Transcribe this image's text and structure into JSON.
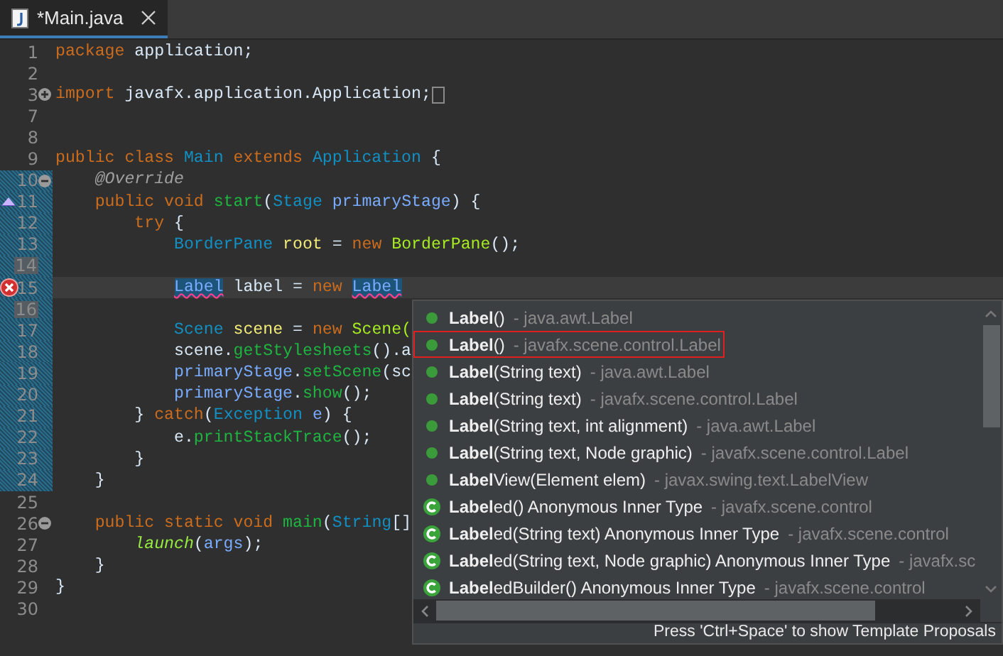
{
  "tab": {
    "title": "*Main.java",
    "dirty": true
  },
  "lines": [
    {
      "number": "1",
      "tokens": [
        {
          "kind": "keyword",
          "text": "package"
        },
        {
          "kind": "plain",
          "text": " application;"
        }
      ]
    },
    {
      "number": "2"
    },
    {
      "number": "3",
      "gutter_icon": {
        "kind": "expand"
      },
      "tokens": [
        {
          "kind": "keyword",
          "text": "import"
        },
        {
          "kind": "plain",
          "text": " javafx.application.Application;"
        }
      ],
      "folded": true
    },
    {
      "number": "7"
    },
    {
      "number": "8"
    },
    {
      "number": "9",
      "tokens": [
        {
          "kind": "keyword",
          "text": "public class "
        },
        {
          "kind": "type",
          "text": "Main"
        },
        {
          "kind": "keyword",
          "text": " extends "
        },
        {
          "kind": "type",
          "text": "Application"
        },
        {
          "kind": "plain",
          "text": " {"
        }
      ]
    },
    {
      "number": "10",
      "gutter_icon": {
        "kind": "collapse"
      },
      "changed": true,
      "tokens": [
        {
          "kind": "annotation",
          "text": "    @Override"
        }
      ]
    },
    {
      "number": "11",
      "gutter_icon": {
        "kind": "override"
      },
      "changed": true,
      "tokens": [
        {
          "kind": "keyword",
          "text": "    public void "
        },
        {
          "kind": "method",
          "text": "start"
        },
        {
          "kind": "plain",
          "text": "("
        },
        {
          "kind": "type",
          "text": "Stage"
        },
        {
          "kind": "param",
          "text": " primaryStage"
        },
        {
          "kind": "plain",
          "text": ") {"
        }
      ]
    },
    {
      "number": "12",
      "changed": true,
      "tokens": [
        {
          "kind": "keyword",
          "text": "        try"
        },
        {
          "kind": "plain",
          "text": " {"
        }
      ]
    },
    {
      "number": "13",
      "changed": true,
      "tokens": [
        {
          "kind": "type",
          "text": "            BorderPane"
        },
        {
          "kind": "local",
          "text": " root"
        },
        {
          "kind": "plain",
          "text": " = "
        },
        {
          "kind": "keyword",
          "text": "new"
        },
        {
          "kind": "method-plain",
          "text": " BorderPane"
        },
        {
          "kind": "plain",
          "text": "();"
        }
      ]
    },
    {
      "number": "14",
      "changed": true
    },
    {
      "number": "15",
      "gutter_icon": {
        "kind": "error"
      },
      "changed": true,
      "current": true,
      "tokens": [
        {
          "kind": "match",
          "text": "            Label"
        },
        {
          "kind": "plain",
          "text": " label = "
        },
        {
          "kind": "keyword",
          "text": "new"
        },
        {
          "kind": "match",
          "text": " Label"
        }
      ]
    },
    {
      "number": "16",
      "changed": true
    },
    {
      "number": "17",
      "changed": true,
      "tokens": [
        {
          "kind": "type",
          "text": "            Scene"
        },
        {
          "kind": "local",
          "text": " scene"
        },
        {
          "kind": "plain",
          "text": " = "
        },
        {
          "kind": "keyword",
          "text": "new"
        },
        {
          "kind": "method-plain",
          "text": " Scene("
        }
      ]
    },
    {
      "number": "18",
      "changed": true,
      "tokens": [
        {
          "kind": "plain",
          "text": "            scene."
        },
        {
          "kind": "method",
          "text": "getStylesheets"
        },
        {
          "kind": "plain",
          "text": "().a"
        }
      ]
    },
    {
      "number": "19",
      "changed": true,
      "tokens": [
        {
          "kind": "param",
          "text": "            primaryStage"
        },
        {
          "kind": "plain",
          "text": "."
        },
        {
          "kind": "method",
          "text": "setScene"
        },
        {
          "kind": "plain",
          "text": "(sc"
        }
      ]
    },
    {
      "number": "20",
      "changed": true,
      "tokens": [
        {
          "kind": "param",
          "text": "            primaryStage"
        },
        {
          "kind": "plain",
          "text": "."
        },
        {
          "kind": "method",
          "text": "show"
        },
        {
          "kind": "plain",
          "text": "();"
        }
      ]
    },
    {
      "number": "21",
      "changed": true,
      "tokens": [
        {
          "kind": "plain",
          "text": "        } "
        },
        {
          "kind": "keyword",
          "text": "catch"
        },
        {
          "kind": "plain",
          "text": "("
        },
        {
          "kind": "type",
          "text": "Exception"
        },
        {
          "kind": "param",
          "text": " e"
        },
        {
          "kind": "plain",
          "text": ") {"
        }
      ]
    },
    {
      "number": "22",
      "changed": true,
      "tokens": [
        {
          "kind": "plain",
          "text": "            e."
        },
        {
          "kind": "method",
          "text": "printStackTrace"
        },
        {
          "kind": "plain",
          "text": "();"
        }
      ]
    },
    {
      "number": "23",
      "changed": true,
      "tokens": [
        {
          "kind": "plain",
          "text": "        }"
        }
      ]
    },
    {
      "number": "24",
      "changed": true,
      "tokens": [
        {
          "kind": "plain",
          "text": "    }"
        }
      ]
    },
    {
      "number": "25"
    },
    {
      "number": "26",
      "gutter_icon": {
        "kind": "collapse"
      },
      "tokens": [
        {
          "kind": "keyword",
          "text": "    public static void "
        },
        {
          "kind": "method",
          "text": "main"
        },
        {
          "kind": "plain",
          "text": "("
        },
        {
          "kind": "type",
          "text": "String"
        },
        {
          "kind": "plain",
          "text": "[]"
        }
      ]
    },
    {
      "number": "27",
      "tokens": [
        {
          "kind": "static-method",
          "text": "        launch"
        },
        {
          "kind": "plain",
          "text": "("
        },
        {
          "kind": "param",
          "text": "args"
        },
        {
          "kind": "plain",
          "text": ");"
        }
      ]
    },
    {
      "number": "28",
      "tokens": [
        {
          "kind": "plain",
          "text": "    }"
        }
      ]
    },
    {
      "number": "29",
      "tokens": [
        {
          "kind": "plain",
          "text": "}"
        }
      ]
    },
    {
      "number": "30"
    }
  ],
  "proposals": {
    "items": [
      {
        "kind": "method",
        "label": "**Label**()",
        "qualifier": "- java.awt.Label",
        "selected": false
      },
      {
        "kind": "method",
        "label": "**Label**()",
        "qualifier": "- javafx.scene.control.Label",
        "selected": true
      },
      {
        "kind": "method",
        "label": "**Label**(String text)",
        "qualifier": "- java.awt.Label",
        "selected": false
      },
      {
        "kind": "method",
        "label": "**Label**(String text)",
        "qualifier": "- javafx.scene.control.Label",
        "selected": false
      },
      {
        "kind": "method",
        "label": "**Label**(String text, int alignment)",
        "qualifier": "- java.awt.Label",
        "selected": false
      },
      {
        "kind": "method",
        "label": "**Label**(String text, Node graphic)",
        "qualifier": "- javafx.scene.control.Label",
        "selected": false
      },
      {
        "kind": "method",
        "label": "**Label**View(Element elem)",
        "qualifier": "- javax.swing.text.LabelView",
        "selected": false
      },
      {
        "kind": "class",
        "label": "**Label**ed()  Anonymous Inner Type",
        "qualifier": "- javafx.scene.control",
        "selected": false
      },
      {
        "kind": "class",
        "label": "**Label**ed(String text)  Anonymous Inner Type",
        "qualifier": "- javafx.scene.control",
        "selected": false
      },
      {
        "kind": "class",
        "label": "**Label**ed(String text, Node graphic)  Anonymous Inner Type",
        "qualifier": "- javafx.sc",
        "selected": false
      },
      {
        "kind": "class",
        "label": "**Label**edBuilder()  Anonymous Inner Type",
        "qualifier": "- javafx.scene.control",
        "selected": false
      }
    ],
    "status": "Press 'Ctrl+Space' to show Template Proposals"
  }
}
